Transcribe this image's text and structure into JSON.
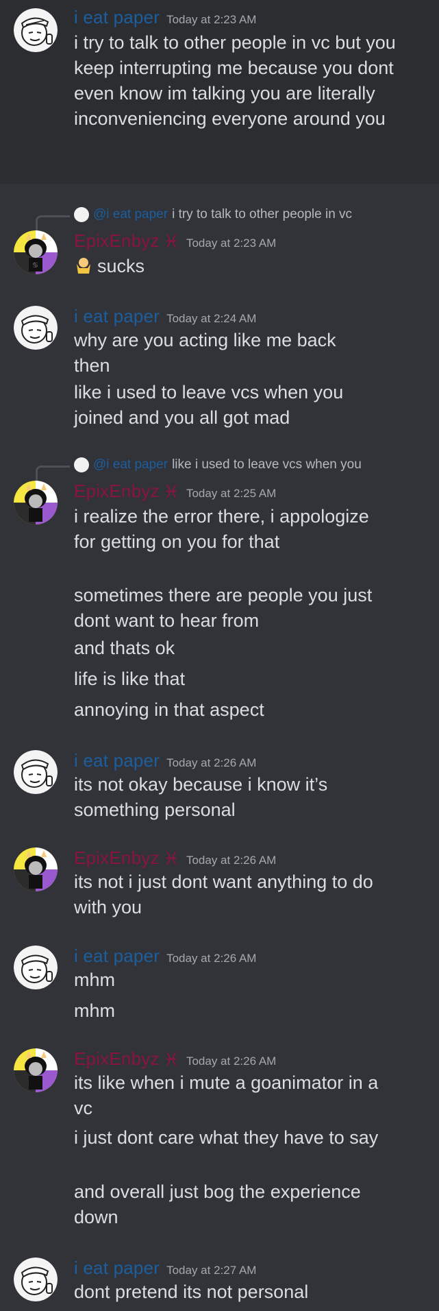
{
  "users": {
    "paper": {
      "name": "i eat paper",
      "color": "#1c5e9e"
    },
    "epix": {
      "name": "EpixEnbyz",
      "color": "#8a1440",
      "badge": "♓"
    }
  },
  "messages": [
    {
      "author": "i eat paper",
      "timestamp": "Today at 2:23 AM",
      "lines": [
        "i try to talk to other people in vc but you keep interrupting me because you dont even know im talking you are literally inconveniencing everyone around you"
      ]
    },
    {
      "author": "EpixEnbyz",
      "timestamp": "Today at 2:23 AM",
      "reply": {
        "name": "@i eat paper",
        "text": "i try to talk to other people in vc"
      },
      "lines": [
        "sucks"
      ],
      "emoji": "person-shrugging-emoji"
    },
    {
      "author": "i eat paper",
      "timestamp": "Today at 2:24 AM",
      "lines": [
        "why are you acting like me back then",
        "like i used to leave vcs when you joined and you all got mad"
      ]
    },
    {
      "author": "EpixEnbyz",
      "timestamp": "Today at 2:25 AM",
      "reply": {
        "name": "@i eat paper",
        "text": "like i used to leave vcs when you"
      },
      "lines": [
        "i realize the error there, i appologize for getting on you for that",
        "sometimes there are people you just dont want to hear from",
        "and thats ok",
        "life is like that",
        "annoying in that aspect"
      ]
    },
    {
      "author": "i eat paper",
      "timestamp": "Today at 2:26 AM",
      "lines": [
        "its not okay because i know it’s something personal"
      ]
    },
    {
      "author": "EpixEnbyz",
      "timestamp": "Today at 2:26 AM",
      "lines": [
        "its not i just dont want anything to do with you"
      ]
    },
    {
      "author": "i eat paper",
      "timestamp": "Today at 2:26 AM",
      "lines": [
        "mhm",
        "mhm"
      ]
    },
    {
      "author": "EpixEnbyz",
      "timestamp": "Today at 2:26 AM",
      "lines": [
        "its like when i mute a goanimator in a vc",
        "i just dont care what they have to say",
        "and overall just bog the experience down"
      ]
    },
    {
      "author": "i eat paper",
      "timestamp": "Today at 2:27 AM",
      "lines": [
        "dont pretend its not personal"
      ]
    }
  ]
}
